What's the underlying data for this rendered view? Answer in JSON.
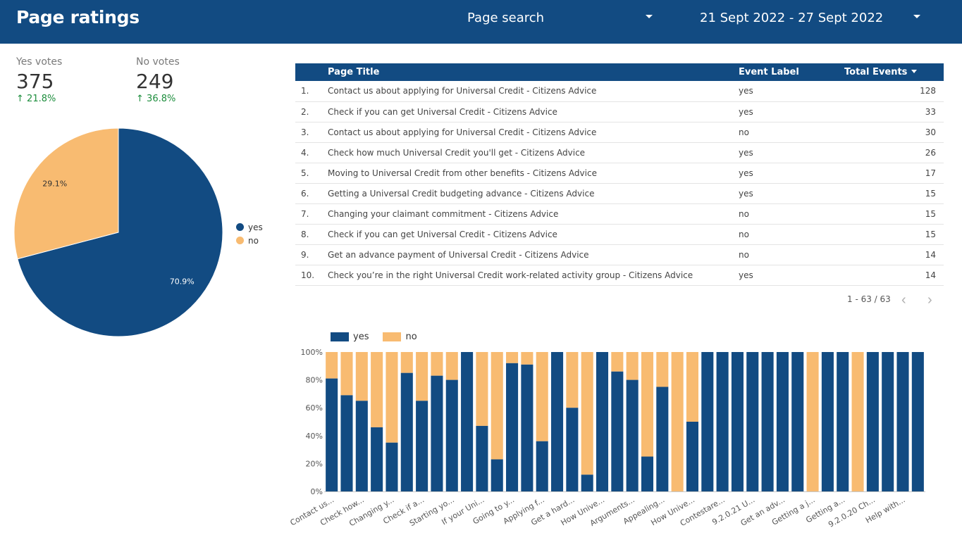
{
  "header": {
    "title": "Page ratings",
    "page_search_label": "Page search",
    "date_range": "21 Sept 2022 - 27 Sept 2022"
  },
  "scorecards": {
    "yes": {
      "label": "Yes votes",
      "value": "375",
      "delta": "21.8%"
    },
    "no": {
      "label": "No votes",
      "value": "249",
      "delta": "36.8%"
    }
  },
  "colors": {
    "yes": "#124b82",
    "no": "#f8bb71",
    "header": "#124b82",
    "positive": "#1e8e3e"
  },
  "pie": {
    "slices": [
      {
        "name": "yes",
        "percent": 70.9,
        "label": "70.9%"
      },
      {
        "name": "no",
        "percent": 29.1,
        "label": "29.1%"
      }
    ]
  },
  "table": {
    "headers": {
      "title": "Page Title",
      "label": "Event Label",
      "total": "Total Events"
    },
    "rows": [
      {
        "num": "1.",
        "title": "Contact us about applying for Universal Credit - Citizens Advice",
        "label": "yes",
        "total": "128"
      },
      {
        "num": "2.",
        "title": "Check if you can get Universal Credit - Citizens Advice",
        "label": "yes",
        "total": "33"
      },
      {
        "num": "3.",
        "title": "Contact us about applying for Universal Credit - Citizens Advice",
        "label": "no",
        "total": "30"
      },
      {
        "num": "4.",
        "title": "Check how much Universal Credit you'll get - Citizens Advice",
        "label": "yes",
        "total": "26"
      },
      {
        "num": "5.",
        "title": "Moving to Universal Credit from other benefits - Citizens Advice",
        "label": "yes",
        "total": "17"
      },
      {
        "num": "6.",
        "title": "Getting a Universal Credit budgeting advance - Citizens Advice",
        "label": "yes",
        "total": "15"
      },
      {
        "num": "7.",
        "title": "Changing your claimant commitment - Citizens Advice",
        "label": "no",
        "total": "15"
      },
      {
        "num": "8.",
        "title": "Check if you can get Universal Credit - Citizens Advice",
        "label": "no",
        "total": "15"
      },
      {
        "num": "9.",
        "title": "Get an advance payment of Universal Credit - Citizens Advice",
        "label": "no",
        "total": "14"
      },
      {
        "num": "10.",
        "title": "Check you’re in the right Universal Credit work-related activity group - Citizens Advice",
        "label": "yes",
        "total": "14"
      }
    ],
    "pagination": "1 - 63 / 63"
  },
  "chart_data": {
    "type": "bar",
    "stacked": "100%",
    "legend": [
      "yes",
      "no"
    ],
    "legend_position": "top-left",
    "ylim": [
      0,
      100
    ],
    "y_ticks": [
      "0%",
      "20%",
      "40%",
      "60%",
      "80%",
      "100%"
    ],
    "grid": false,
    "x_tick_labels": [
      "Contact us...",
      "Check how...",
      "Changing y...",
      "Check if a...",
      "Starting yo...",
      "If your Uni...",
      "Going to y...",
      "Applying f...",
      "Get a hard...",
      "How Unive...",
      "Arguments...",
      "Appealing...",
      "How Unive...",
      "Contestare...",
      "9.2.0.21 U...",
      "Get an adv...",
      "Getting a j...",
      "Getting a...",
      "9.2.0.20 Ch...",
      "Help with..."
    ],
    "series": [
      {
        "name": "yes",
        "values": [
          81,
          69,
          65,
          46,
          35,
          85,
          65,
          83,
          80,
          100,
          47,
          23,
          92,
          91,
          36,
          100,
          60,
          12,
          100,
          86,
          80,
          25,
          75,
          0,
          50,
          100,
          100,
          100,
          100,
          100,
          100,
          100,
          0,
          100,
          100,
          0,
          100,
          100,
          100,
          100
        ]
      },
      {
        "name": "no",
        "values": [
          19,
          31,
          35,
          54,
          65,
          15,
          35,
          17,
          20,
          0,
          53,
          77,
          8,
          9,
          64,
          0,
          40,
          88,
          0,
          14,
          20,
          75,
          25,
          100,
          50,
          0,
          0,
          0,
          0,
          0,
          0,
          0,
          100,
          0,
          0,
          100,
          0,
          0,
          0,
          0
        ]
      }
    ]
  }
}
